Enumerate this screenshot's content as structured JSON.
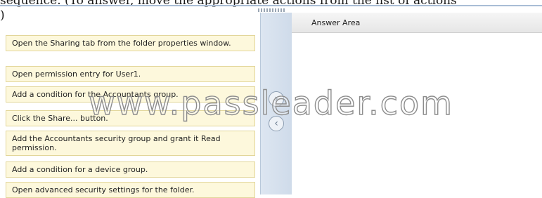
{
  "header": {
    "question_fragment": "sequence. (To answer, move the appropriate actions from the list of actions",
    "paren": ")"
  },
  "actions": [
    {
      "label": "Open the Sharing tab from the folder properties window."
    },
    {
      "label": "Open permission entry for User1."
    },
    {
      "label": "Add a condition for the Accountants group."
    },
    {
      "label": "Click the Share... button."
    },
    {
      "label": "Add the Accountants security group and grant it Read permission."
    },
    {
      "label": "Add a condition for a device group."
    },
    {
      "label": "Open advanced security settings for the folder."
    }
  ],
  "answer_area": {
    "title": "Answer Area"
  },
  "controls": {
    "move_right_icon": "arrow-right-icon",
    "move_left_icon": "arrow-left-icon",
    "move_right_glyph": "›",
    "move_left_glyph": "‹"
  },
  "watermark": {
    "text": "www.passleader.com"
  }
}
